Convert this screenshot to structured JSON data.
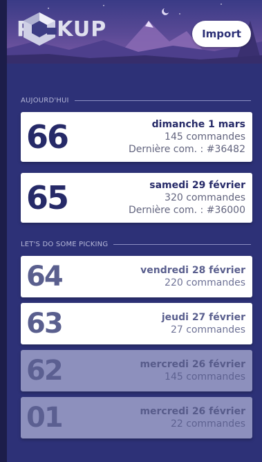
{
  "app": {
    "logo_text": "PICKUP",
    "import_label": "Import"
  },
  "sections": {
    "today_title": "AUJOURD'HUI",
    "picking_title": "LET'S DO SOME PICKING"
  },
  "today": [
    {
      "number": "66",
      "date": "dimanche 1 mars",
      "orders": "145 commandes",
      "last_order": "Dernière com. : #36482"
    },
    {
      "number": "65",
      "date": "samedi 29 février",
      "orders": "320 commandes",
      "last_order": "Dernière com. : #36000"
    }
  ],
  "picking": [
    {
      "number": "64",
      "date": "vendredi 28 février",
      "orders": "220 commandes"
    },
    {
      "number": "63",
      "date": "jeudi 27 février",
      "orders": "27 commandes"
    },
    {
      "number": "62",
      "date": "mercredi 26 février",
      "orders": "145 commandes"
    },
    {
      "number": "01",
      "date": "mercredi 26 février",
      "orders": "22 commandes"
    }
  ],
  "colors": {
    "background": "#2d3177",
    "card": "#ffffff",
    "card_faded": "#8d90bd",
    "accent_dark": "#262a68"
  }
}
